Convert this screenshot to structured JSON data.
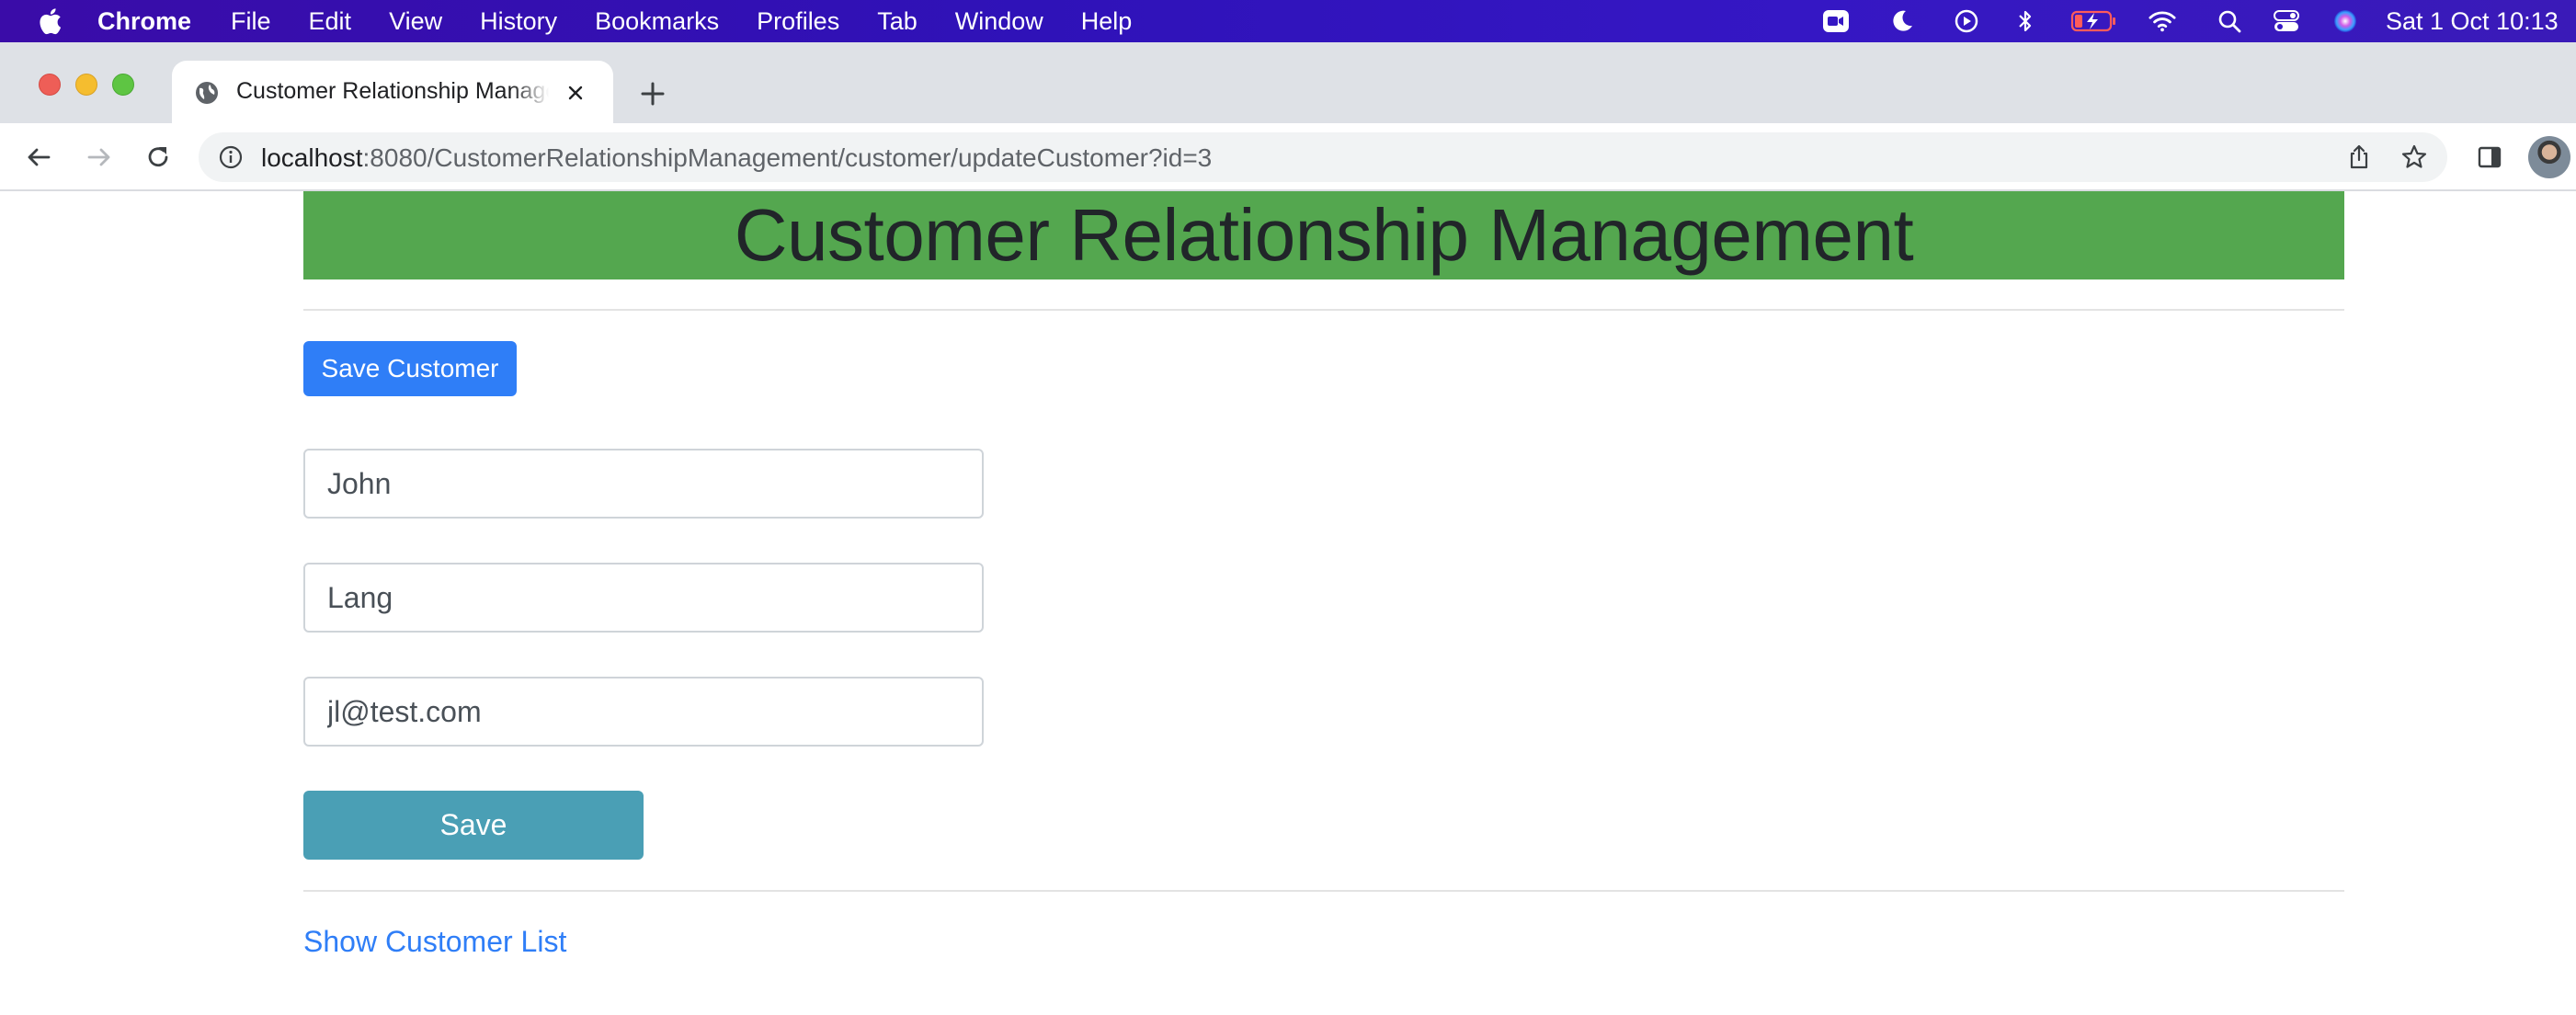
{
  "menubar": {
    "app_name": "Chrome",
    "items": [
      "File",
      "Edit",
      "View",
      "History",
      "Bookmarks",
      "Profiles",
      "Tab",
      "Window",
      "Help"
    ],
    "clock": "Sat 1 Oct  10:13"
  },
  "browser": {
    "tab_title": "Customer Relationship Management",
    "url_host": "localhost",
    "url_path": ":8080/CustomerRelationshipManagement/customer/updateCustomer?id=3"
  },
  "page": {
    "heading": "Customer Relationship Management",
    "save_customer_button": "Save Customer",
    "fields": {
      "first_name": "John",
      "last_name": "Lang",
      "email": "jl@test.com"
    },
    "save_button": "Save",
    "show_list_link": "Show Customer List"
  },
  "colors": {
    "banner": "#54a74f",
    "primary": "#2f7ef7",
    "save": "#4a9fb5",
    "menubar": "#3517c4"
  }
}
